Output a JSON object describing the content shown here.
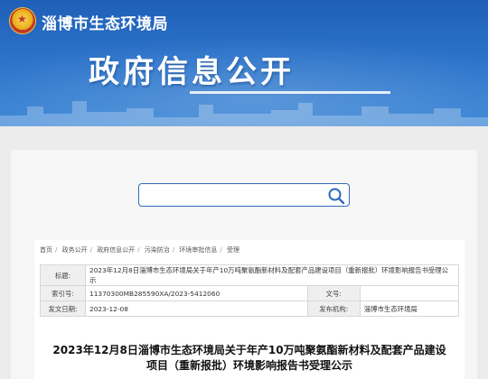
{
  "header": {
    "org_name": "淄博市生态环境局",
    "banner_title": "政府信息公开"
  },
  "search": {
    "placeholder": "",
    "value": ""
  },
  "breadcrumb": [
    "首页",
    "政务公开",
    "政府信息公开",
    "污染防治",
    "环境审批信息",
    "受理"
  ],
  "breadcrumb_separator": "/",
  "meta": {
    "title_label": "标题:",
    "title_value": "2023年12月8日淄博市生态环境局关于年产10万吨聚氨酯新材料及配套产品建设项目（重新报批）环境影响报告书受理公示",
    "index_label": "索引号:",
    "index_value": "11370300MB285590XA/2023-5412060",
    "docno_label": "文号:",
    "docno_value": "",
    "date_label": "发文日期:",
    "date_value": "2023-12-08",
    "issuer_label": "发布机构:",
    "issuer_value": "淄博市生态环境局"
  },
  "document": {
    "title_line1": "2023年12月8日淄博市生态环境局关于年产10万吨聚氨酯新材料及配套产品建设",
    "title_line2": "项目（重新报批）环境影响报告书受理公示"
  },
  "colors": {
    "banner_blue": "#2b72c9",
    "search_border": "#2e6bbd",
    "page_bg": "#ececec"
  },
  "icons": {
    "emblem": "national-emblem-icon",
    "search": "search-icon"
  }
}
